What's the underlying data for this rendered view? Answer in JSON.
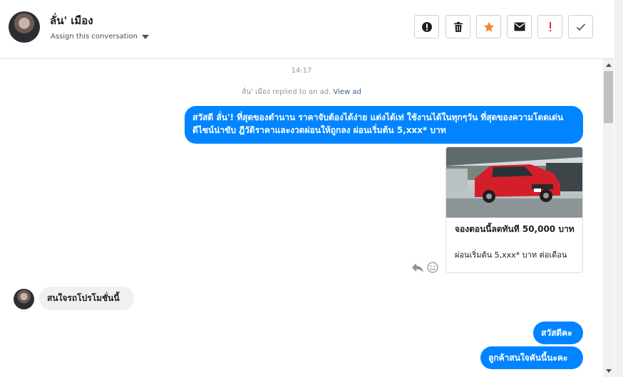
{
  "header": {
    "contact_name": "ลั่น' เมือง",
    "assign_label": "Assign this conversation",
    "toolbar": {
      "spam_icon": "alert-circle-icon",
      "delete_icon": "trash-icon",
      "star_icon": "star-icon",
      "star_color": "#f5862a",
      "mark_unread_icon": "envelope-icon",
      "important_icon": "exclamation-icon",
      "important_color": "#e32727",
      "done_icon": "checkmark-icon"
    }
  },
  "thread": {
    "timestamp": "14:17",
    "replied_text": "ลั่น' เมือง replied to an ad.",
    "replied_link": "View ad",
    "messages": [
      {
        "direction": "outgoing",
        "text": "สวัสดี ลั่น'! ที่สุดของตำนาน ราคาจับต้องได้ง่าย แต่งได้เท่ ใช้งานได้ในทุกๆวัน ที่สุดของความโดดเด่น ดีไซน์น่าขับ ฎีวัดิราคาและงวดผ่อนให้ถูกลง ผ่อนเริ่มต้น 5,xxx* บาท"
      },
      {
        "direction": "outgoing",
        "type": "ad-card",
        "title": "จองตอนนี้ลดทันที 50,000 บาท",
        "subtitle": "ผ่อนเริ่มต้น 5,xxx* บาท ต่อเดือน"
      },
      {
        "direction": "incoming",
        "text": "สนใจรถโปรโมชั่นนี้"
      },
      {
        "direction": "outgoing",
        "text": "สวัสดีคะ"
      },
      {
        "direction": "outgoing",
        "text": "ลูกค้าสนใจคันนี้นะคะ"
      }
    ],
    "message_actions": {
      "reply_icon": "reply-icon",
      "react_icon": "smiley-icon"
    }
  },
  "colors": {
    "accent": "#0084ff",
    "incoming_bubble": "#f1f0f0"
  }
}
